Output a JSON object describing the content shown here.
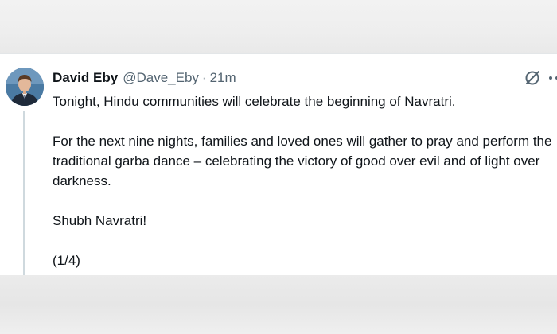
{
  "tweet": {
    "author": {
      "display_name": "David Eby",
      "handle": "@Dave_Eby",
      "avatar_icon": "profile-photo"
    },
    "separator": "·",
    "timestamp": "21m",
    "paragraphs": [
      "Tonight, Hindu communities will celebrate the beginning of Navratri.",
      "For the next nine nights, families and loved ones will gather to pray and perform the traditional garba dance – celebrating the victory of good over evil and of light over darkness.",
      "Shubh Navratri!",
      "(1/4)"
    ],
    "actions": {
      "grok_icon": "grok-icon",
      "more_icon": "more-options-icon"
    }
  },
  "colors": {
    "text_primary": "#0f1419",
    "text_secondary": "#536471",
    "thread_line": "#cfd9de",
    "card_background": "#ffffff"
  }
}
